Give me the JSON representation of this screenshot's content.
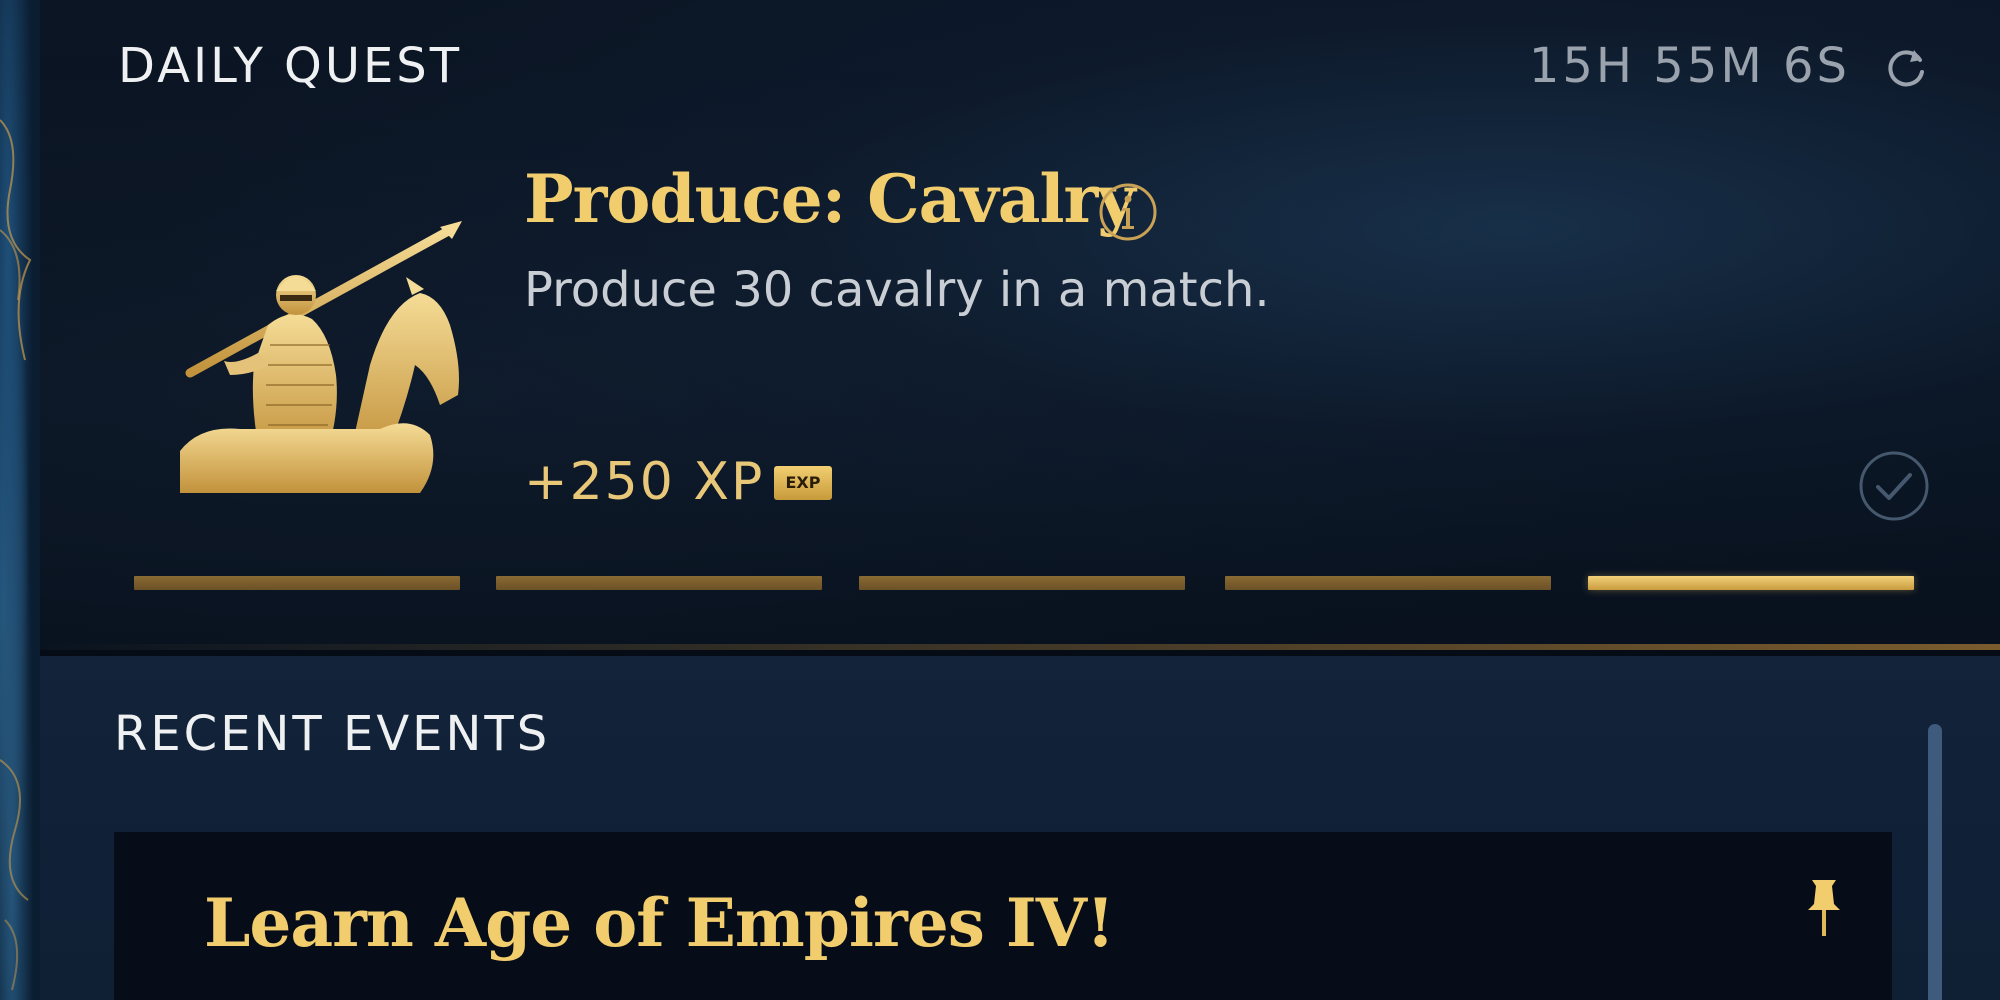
{
  "daily_quest": {
    "header": "DAILY QUEST",
    "timer": "15H 55M 6S",
    "title": "Produce: Cavalry",
    "description": "Produce 30 cavalry in a match.",
    "reward": "+250 XP",
    "reward_badge": "EXP",
    "progress_segments": 5,
    "current_segment": 5,
    "icons": {
      "refresh": "refresh-icon",
      "unit": "cavalry-unit-icon",
      "info": "info-icon",
      "complete": "checkmark-circle-icon"
    }
  },
  "recent_events": {
    "header": "RECENT EVENTS",
    "items": [
      {
        "title": "Learn Age of Empires IV!",
        "pinned": true,
        "icon": "pin-icon"
      }
    ]
  },
  "colors": {
    "gold": "#f1cd6e",
    "header_text": "#eef0f2",
    "muted_text": "#9aa3ad",
    "progress_done": "#8a6a33",
    "progress_current": "#f3d27a",
    "panel_bg": "#08111d",
    "events_bg": "#12233a"
  }
}
